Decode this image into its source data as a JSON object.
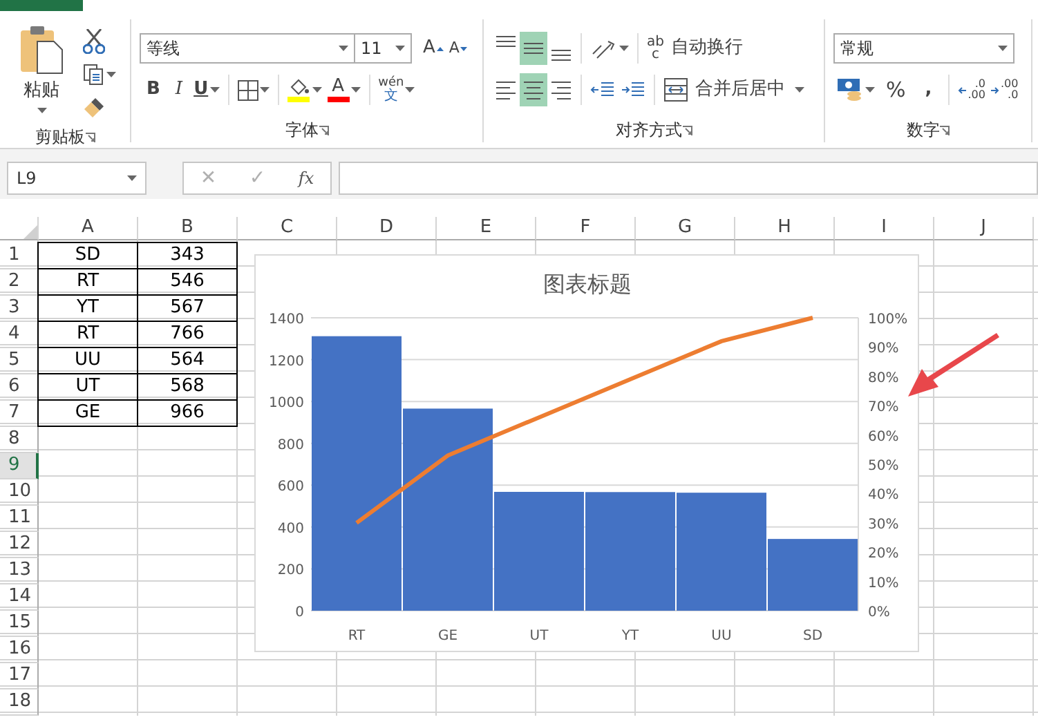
{
  "ribbon": {
    "clipboard": {
      "label": "剪贴板",
      "paste": "粘贴"
    },
    "font": {
      "label": "字体",
      "font_name": "等线",
      "font_size": "11",
      "grow": "A",
      "shrink": "A",
      "bold": "B",
      "italic": "I",
      "underline": "U",
      "font_color": "A",
      "phonetic_top": "wén",
      "phonetic_bottom": "文"
    },
    "alignment": {
      "label": "对齐方式",
      "vertical": [
        {
          "selected": false
        },
        {
          "selected": true
        },
        {
          "selected": false
        }
      ],
      "horizontal": [
        {
          "selected": false
        },
        {
          "selected": true
        },
        {
          "selected": false
        }
      ],
      "wrap_icon": [
        "ab",
        "c"
      ],
      "wrap_text": "自动换行",
      "merge_center": "合并后居中"
    },
    "number": {
      "label": "数字",
      "format": "常规",
      "percent": "%",
      "comma": ",",
      "increase_decimal": [
        ".0",
        ".00"
      ],
      "decrease_decimal": [
        ".00",
        ".0"
      ]
    }
  },
  "formula_bar": {
    "name_box": "L9",
    "cancel": "✕",
    "enter": "✓",
    "function": "fx"
  },
  "sheet": {
    "columns": [
      "A",
      "B",
      "C",
      "D",
      "E",
      "F",
      "G",
      "H",
      "I",
      "J"
    ],
    "rows": [
      {
        "label": "1",
        "selected": false,
        "cells": [
          "SD",
          "343"
        ]
      },
      {
        "label": "2",
        "selected": false,
        "cells": [
          "RT",
          "546"
        ]
      },
      {
        "label": "3",
        "selected": false,
        "cells": [
          "YT",
          "567"
        ]
      },
      {
        "label": "4",
        "selected": false,
        "cells": [
          "RT",
          "766"
        ]
      },
      {
        "label": "5",
        "selected": false,
        "cells": [
          "UU",
          "564"
        ]
      },
      {
        "label": "6",
        "selected": false,
        "cells": [
          "UT",
          "568"
        ]
      },
      {
        "label": "7",
        "selected": false,
        "cells": [
          "GE",
          "966"
        ]
      },
      {
        "label": "8",
        "selected": false
      },
      {
        "label": "9",
        "selected": true
      },
      {
        "label": "10",
        "selected": false
      },
      {
        "label": "11",
        "selected": false
      },
      {
        "label": "12",
        "selected": false
      },
      {
        "label": "13",
        "selected": false
      },
      {
        "label": "14",
        "selected": false
      },
      {
        "label": "15",
        "selected": false
      },
      {
        "label": "16",
        "selected": false
      },
      {
        "label": "17",
        "selected": false
      },
      {
        "label": "18",
        "selected": false
      }
    ]
  },
  "chart": {
    "chart_data": {
      "type": "bar",
      "title": "图表标题",
      "categories": [
        "RT",
        "GE",
        "UT",
        "YT",
        "UU",
        "SD"
      ],
      "series": [
        {
          "color": "#4472c4",
          "values": [
            1312,
            966,
            568,
            567,
            564,
            343
          ]
        },
        {
          "color": "#ed7d31",
          "type": "line",
          "axis": "y2",
          "values": [
            0.3,
            0.53,
            0.66,
            0.79,
            0.92,
            1
          ]
        }
      ],
      "grid": true,
      "ylim": [
        0,
        1400
      ],
      "y2lim": [
        0,
        1
      ],
      "yticks": [
        0,
        200,
        400,
        600,
        800,
        1000,
        1200,
        1400
      ],
      "y2ticks": [
        {
          "value": 0,
          "label": "0%"
        },
        {
          "value": 0.1,
          "label": "10%"
        },
        {
          "value": 0.2,
          "label": "20%"
        },
        {
          "value": 0.3,
          "label": "30%"
        },
        {
          "value": 0.4,
          "label": "40%"
        },
        {
          "value": 0.5,
          "label": "50%"
        },
        {
          "value": 0.6,
          "label": "60%"
        },
        {
          "value": 0.7,
          "label": "70%"
        },
        {
          "value": 0.8,
          "label": "80%"
        },
        {
          "value": 0.9,
          "label": "90%"
        },
        {
          "value": 1,
          "label": "100%"
        }
      ]
    },
    "annotation": {
      "kind": "arrow",
      "color": "#e8474b"
    }
  }
}
